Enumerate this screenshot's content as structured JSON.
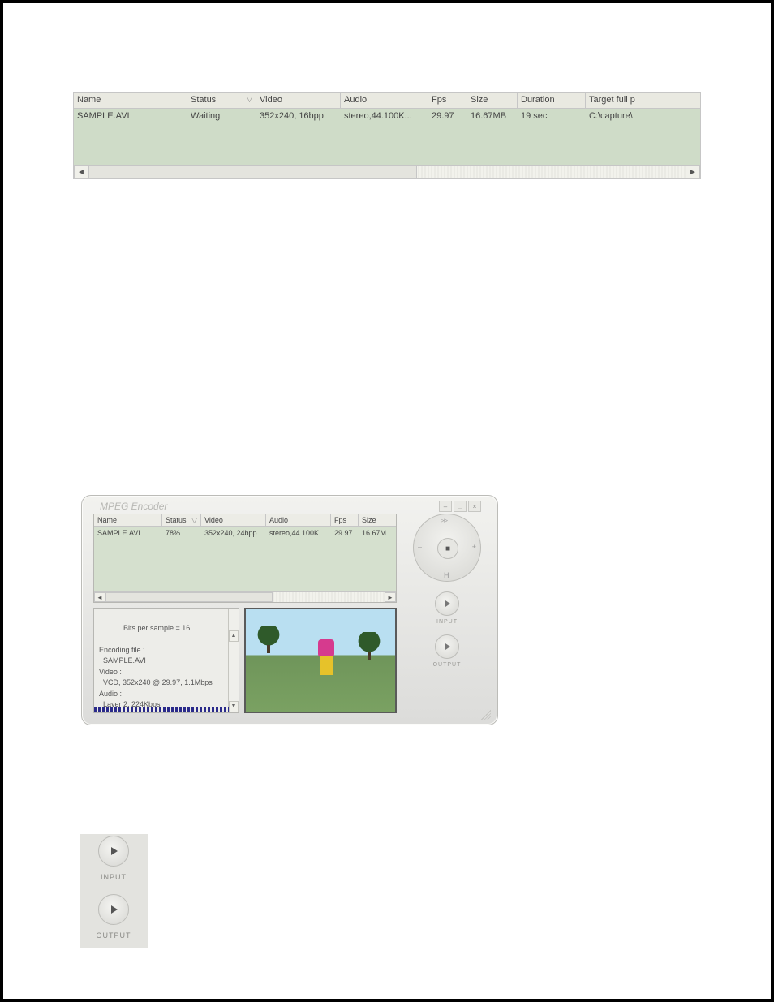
{
  "file_list_top": {
    "columns": {
      "name": "Name",
      "status": "Status",
      "video": "Video",
      "audio": "Audio",
      "fps": "Fps",
      "size": "Size",
      "duration": "Duration",
      "target": "Target full p"
    },
    "sort_glyph": "▽",
    "row": {
      "name": "SAMPLE.AVI",
      "status": "Waiting",
      "video": "352x240, 16bpp",
      "audio": "stereo,44.100K...",
      "fps": "29.97",
      "size": "16.67MB",
      "duration": "19 sec",
      "target": "C:\\capture\\"
    }
  },
  "encoder_window": {
    "title": "MPEG Encoder",
    "window_buttons": {
      "min": "–",
      "max": "□",
      "close": "×"
    },
    "grid": {
      "columns": {
        "name": "Name",
        "status": "Status",
        "video": "Video",
        "audio": "Audio",
        "fps": "Fps",
        "size": "Size"
      },
      "sort_glyph": "▽",
      "row": {
        "name": "SAMPLE.AVI",
        "status": "78%",
        "video": "352x240, 24bpp",
        "audio": "stereo,44.100K...",
        "fps": "29.97",
        "size": "16.67M"
      }
    },
    "log_text": "Bits per sample = 16\n\nEncoding file :\n  SAMPLE.AVI\nVideo :\n  VCD, 352x240 @ 29.97, 1.1Mbps\nAudio :\n  Layer 2, 224Kbps",
    "navpad": {
      "center_glyph": "■",
      "top": "▹▹",
      "bottom": "H",
      "left": "–",
      "right": "+"
    },
    "input_label": "INPUT",
    "output_label": "OUTPUT"
  },
  "io_detail": {
    "input_label": "INPUT",
    "output_label": "OUTPUT"
  },
  "scroll": {
    "left_glyph": "◄",
    "right_glyph": "►",
    "up_glyph": "▲",
    "down_glyph": "▼"
  }
}
